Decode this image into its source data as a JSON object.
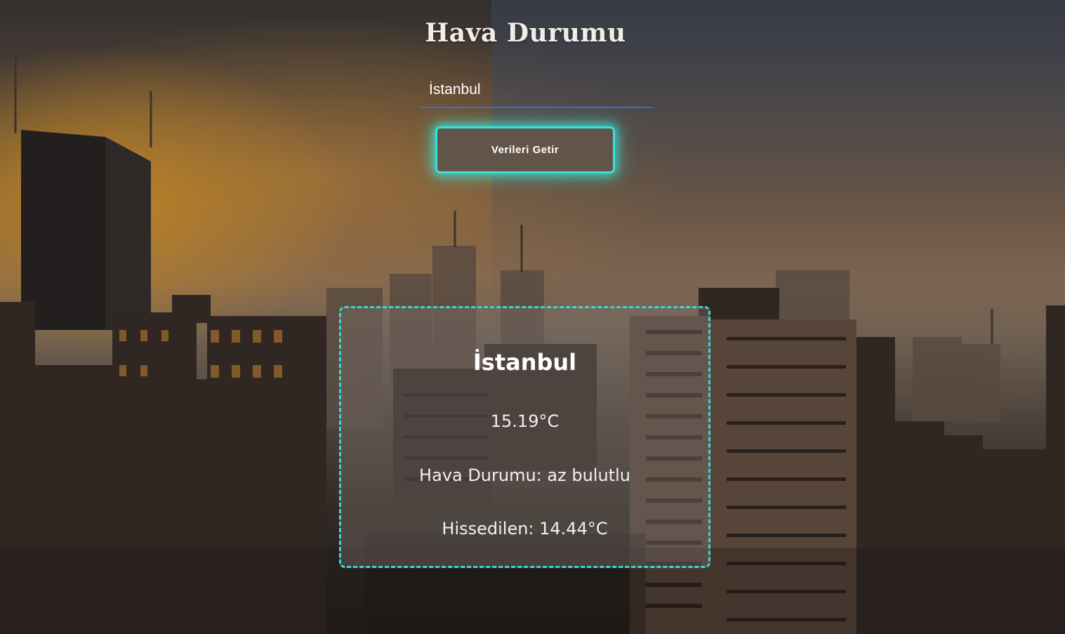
{
  "header": {
    "title": "Hava Durumu"
  },
  "search": {
    "value": "İstanbul",
    "placeholder": ""
  },
  "button": {
    "label": "Verileri Getir"
  },
  "weather": {
    "city": "İstanbul",
    "temperature": "15.19°C",
    "description": "Hava Durumu: az bulutlu",
    "feels_like": "Hissedilen: 14.44°C"
  },
  "colors": {
    "accent_glow": "#3ad6d0",
    "input_underline": "#2f6fd8",
    "button_bg": "#62544a"
  }
}
